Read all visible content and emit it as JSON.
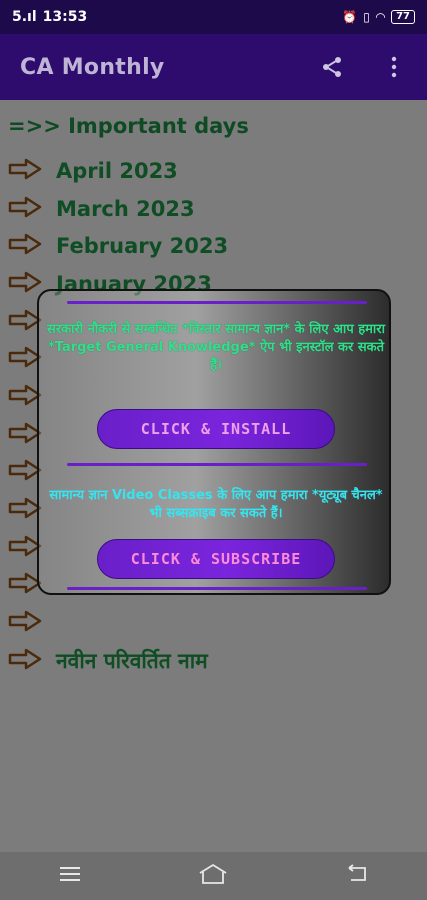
{
  "status": {
    "network": "5.ıl",
    "time": "13:53",
    "battery": "77"
  },
  "appbar": {
    "title": "CA Monthly",
    "share_icon": "share-icon",
    "menu_icon": "more-vert-icon"
  },
  "content": {
    "section_heading": "=>> Important days",
    "months": [
      "April 2023",
      "March 2023",
      "February 2023",
      "January 2023",
      "",
      "",
      "",
      "",
      "",
      "",
      "",
      "",
      "",
      "नवीन परिवर्तित नाम"
    ]
  },
  "dialog": {
    "message_install": "सरकारी नौकरी से सम्बन्धित *विस्तार सामान्य ज्ञान* के लिए आप हमारा *Target General Knowledge* ऐप भी इनस्टॉल कर सकते हैं।",
    "install_label": "CLICK & INSTALL",
    "message_subscribe": "सामान्य ज्ञान Video Classes के लिए आप हमारा *यूट्यूब चैनल* भी सब्सक्राइब कर सकते हैं।",
    "subscribe_label": "CLICK & SUBSCRIBE"
  },
  "navbar": {
    "menu": "menu-icon",
    "home": "home-icon",
    "back": "back-icon"
  },
  "colors": {
    "appbar": "#2d0c6d",
    "accent": "#6a1fc9",
    "list_text": "#0f4d24",
    "install_text": "#2fe08a",
    "subscribe_text": "#35e5f0"
  }
}
